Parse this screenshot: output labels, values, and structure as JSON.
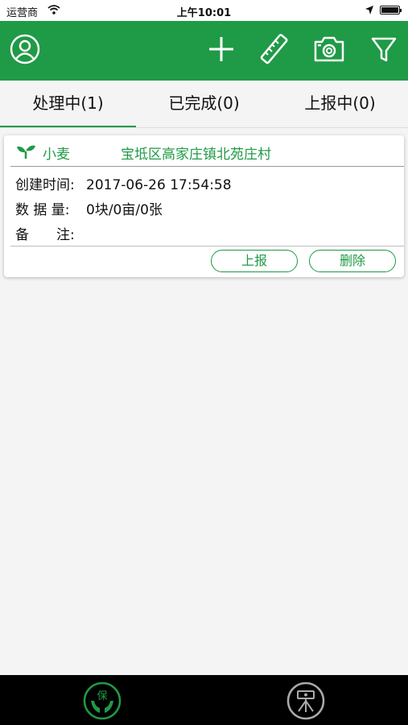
{
  "status_bar": {
    "carrier": "运营商",
    "time": "上午10:01"
  },
  "toolbar": {
    "icons": [
      "user-icon",
      "plus-icon",
      "ruler-icon",
      "camera-icon",
      "filter-icon"
    ],
    "color": "#1f9a46"
  },
  "tabs": [
    {
      "label": "处理中(1)",
      "active": true
    },
    {
      "label": "已完成(0)",
      "active": false
    },
    {
      "label": "上报中(0)",
      "active": false
    }
  ],
  "card": {
    "crop": "小麦",
    "location": "宝坻区高家庄镇北苑庄村",
    "created_label": "创建时间:",
    "created_value": "2017-06-26 17:54:58",
    "data_label": "数 据 量:",
    "data_value": "0块/0亩/0张",
    "note_label": "备　　注:",
    "note_value": "",
    "report_button": "上报",
    "delete_button": "删除"
  },
  "bottom_bar": {
    "items": [
      {
        "char": "保",
        "icon": "protect-hands-icon",
        "active": true
      },
      {
        "char": "采",
        "icon": "collect-tripod-icon",
        "active": false
      }
    ],
    "active_color": "#1f9a46",
    "inactive_color": "#aaaaaa"
  }
}
